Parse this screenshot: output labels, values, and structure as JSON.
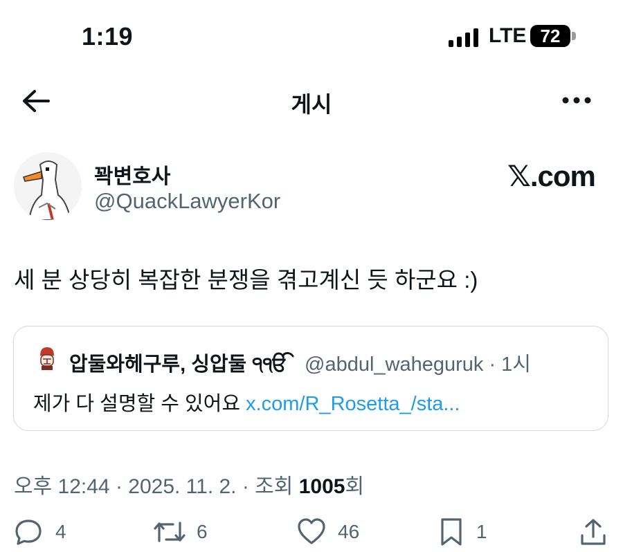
{
  "status_bar": {
    "time": "1:19",
    "network": "LTE",
    "battery": "72"
  },
  "header": {
    "title": "게시"
  },
  "author": {
    "name": "꽉변호사",
    "handle": "@QuackLawyerKor",
    "source": "𝕏.com"
  },
  "post": {
    "text": "세 분 상당히 복잡한 분쟁을 겪고계신 듯 하군요 :)"
  },
  "quote": {
    "name": "압둘와헤구루, 싱압둘 ੧ੴ",
    "meta": "@abdul_waheguruk · 1시",
    "text": "제가 다 설명할 수 있어요 ",
    "link": "x.com/R_Rosetta_/sta..."
  },
  "meta": {
    "timestamp": "오후 12:44 · 2025. 11. 2. · 조회 ",
    "views": "1005",
    "views_suffix": "회"
  },
  "actions": {
    "replies": "4",
    "reposts": "6",
    "likes": "46",
    "bookmarks": "1"
  },
  "colors": {
    "text": "#0f1419",
    "secondary": "#536471",
    "link": "#1d9bf0",
    "border": "#cfd9de"
  }
}
